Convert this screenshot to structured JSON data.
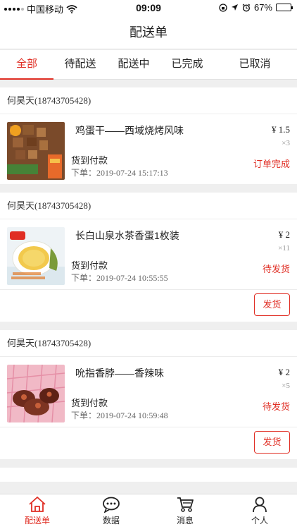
{
  "status_bar": {
    "carrier": "中国移动",
    "time": "09:09",
    "battery": "67%",
    "battery_level": 0.67,
    "icons": [
      "signal-icon",
      "wifi-icon",
      "orientation-lock-icon",
      "location-icon",
      "alarm-icon",
      "battery-icon"
    ]
  },
  "header": {
    "title": "配送单"
  },
  "tabs": [
    {
      "label": "全部",
      "active": true
    },
    {
      "label": "待配送"
    },
    {
      "label": "配送中"
    },
    {
      "label": "已完成"
    },
    {
      "label": "已取消"
    }
  ],
  "orders": [
    {
      "customer": "何昊天(18743705428)",
      "product": "鸡蛋干——西域烧烤风味",
      "price": "¥ 1.5",
      "qty": "×3",
      "payment": "货到付款",
      "date": "下单：2019-07-24 15:17:13",
      "status": "订单完成",
      "action": ""
    },
    {
      "customer": "何昊天(18743705428)",
      "product": "长白山泉水茶香蛋1枚装",
      "price": "¥ 2",
      "qty": "×11",
      "payment": "货到付款",
      "date": "下单：2019-07-24 10:55:55",
      "status": "待发货",
      "action": "发货"
    },
    {
      "customer": "何昊天(18743705428)",
      "product": "吮指香脖——香辣味",
      "price": "¥ 2",
      "qty": "×5",
      "payment": "货到付款",
      "date": "下单：2019-07-24 10:59:48",
      "status": "待发货",
      "action": "发货"
    }
  ],
  "tabbar": [
    {
      "label": "配送单",
      "icon": "home-icon",
      "active": true
    },
    {
      "label": "数据",
      "icon": "chat-icon"
    },
    {
      "label": "消息",
      "icon": "cart-icon"
    },
    {
      "label": "个人",
      "icon": "person-icon"
    }
  ],
  "colors": {
    "accent": "#e02e24",
    "background": "#efefef",
    "text": "#222222"
  }
}
